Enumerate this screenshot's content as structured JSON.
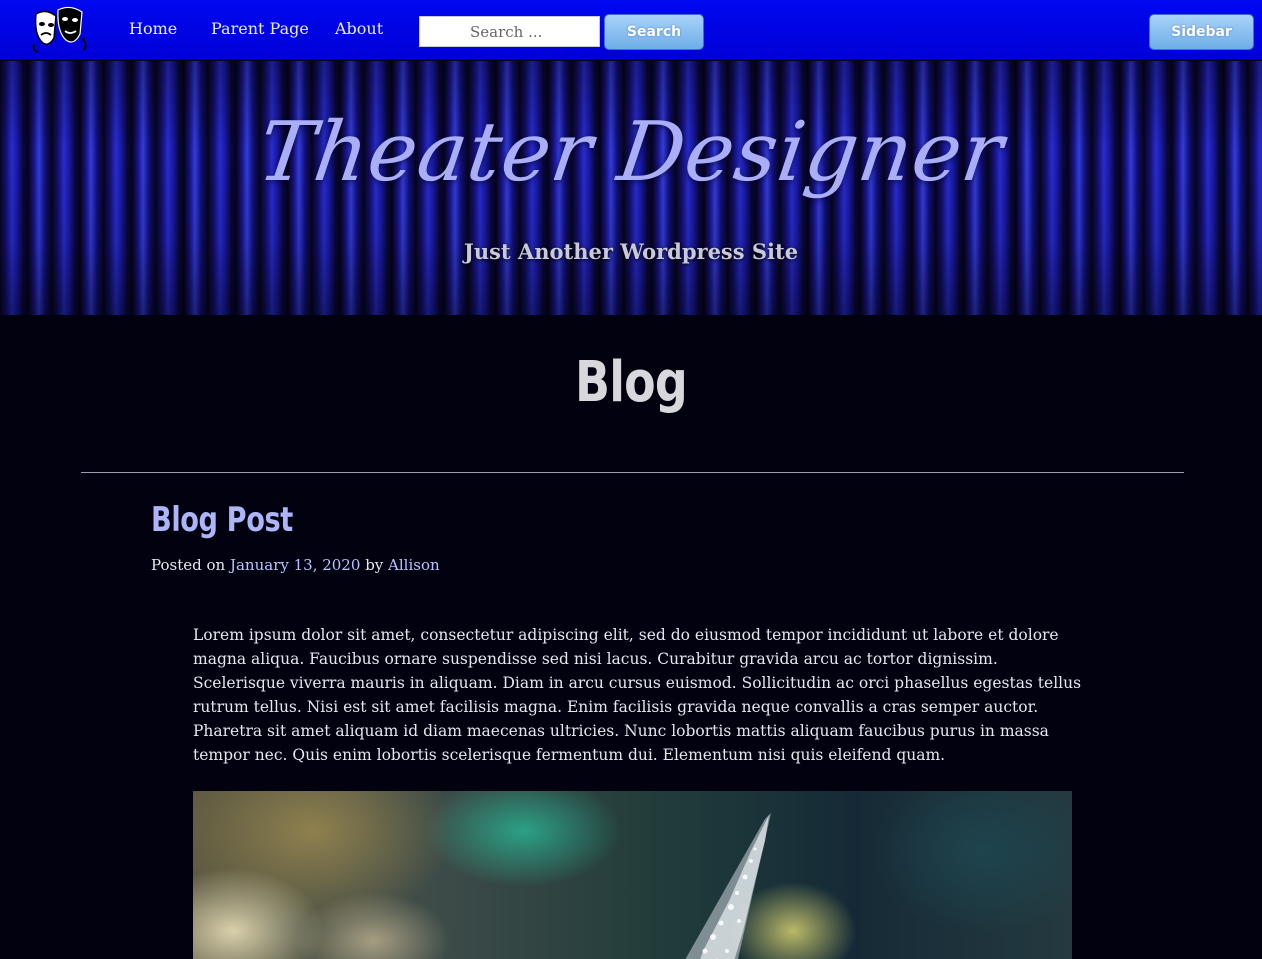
{
  "nav": {
    "links": [
      "Home",
      "Parent Page",
      "About"
    ],
    "search_placeholder": "Search ...",
    "search_button": "Search",
    "sidebar_button": "Sidebar"
  },
  "header": {
    "site_title": "Theater Designer",
    "tagline": "Just Another Wordpress Site"
  },
  "main": {
    "page_title": "Blog",
    "post": {
      "title": "Blog Post",
      "meta_prefix": "Posted on",
      "date": "January 13, 2020",
      "meta_by": "by",
      "author": "Allison",
      "body": "Lorem ipsum dolor sit amet, consectetur adipiscing elit, sed do eiusmod tempor incididunt ut labore et dolore magna aliqua. Faucibus ornare suspendisse sed nisi lacus. Curabitur gravida arcu ac tortor dignissim. Scelerisque viverra mauris in aliquam. Diam in arcu cursus euismod. Sollicitudin ac orci phasellus egestas tellus rutrum tellus. Nisi est sit amet facilisis magna. Enim facilisis gravida neque convallis a cras semper auctor. Pharetra sit amet aliquam id diam maecenas ultricies. Nunc lobortis mattis aliquam faucibus purus in massa tempor nec. Quis enim lobortis scelerisque fermentum dui. Elementum nisi quis eleifend quam."
    }
  },
  "colors": {
    "nav_bg": "#0000e0",
    "accent_title": "#aeb4f8",
    "link": "#b9c3ff",
    "page_bg": "#01010f"
  },
  "icons": {
    "logo": "theater-masks-icon"
  }
}
